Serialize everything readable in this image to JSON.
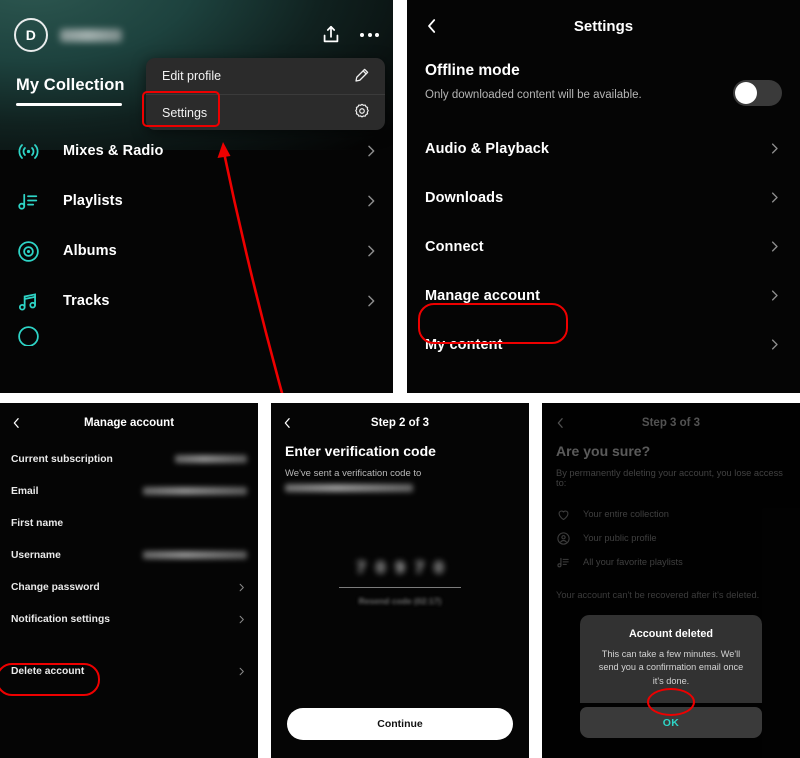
{
  "collection": {
    "avatar_initial": "D",
    "username_redacted": true,
    "title": "My Collection",
    "actions": [
      {
        "name": "share-icon",
        "label": "Share"
      },
      {
        "name": "more-icon",
        "label": "More"
      }
    ],
    "menu": [
      {
        "label": "Edit profile",
        "icon": "pencil-icon"
      },
      {
        "label": "Settings",
        "icon": "gear-icon",
        "highlighted": true
      }
    ],
    "items": [
      {
        "label": "Mixes & Radio",
        "icon": "radio-waves-icon"
      },
      {
        "label": "Playlists",
        "icon": "playlist-icon"
      },
      {
        "label": "Albums",
        "icon": "disc-icon"
      },
      {
        "label": "Tracks",
        "icon": "music-note-icon"
      }
    ],
    "accent": "#2ed4c6"
  },
  "settings": {
    "nav_title": "Settings",
    "back_icon": "chevron-left-icon",
    "offline": {
      "title": "Offline mode",
      "subtitle": "Only downloaded content will be available.",
      "toggle_state": "off"
    },
    "rows": [
      {
        "label": "Audio & Playback",
        "highlighted": false
      },
      {
        "label": "Downloads",
        "highlighted": false
      },
      {
        "label": "Connect",
        "highlighted": false
      },
      {
        "label": "Manage account",
        "highlighted": true
      },
      {
        "label": "My content",
        "highlighted": false
      }
    ]
  },
  "manage": {
    "nav_title": "Manage account",
    "rows": [
      {
        "label": "Current subscription",
        "value_redacted": true,
        "value_width": 72,
        "chevron": false
      },
      {
        "label": "Email",
        "value_redacted": true,
        "value_width": 104,
        "chevron": false
      },
      {
        "label": "First name",
        "value_redacted": false,
        "value_width": 0,
        "chevron": false
      },
      {
        "label": "Username",
        "value_redacted": true,
        "value_width": 104,
        "chevron": false
      },
      {
        "label": "Change password",
        "value_redacted": false,
        "value_width": 0,
        "chevron": true
      },
      {
        "label": "Notification settings",
        "value_redacted": false,
        "value_width": 0,
        "chevron": true
      },
      {
        "label": "Delete account",
        "value_redacted": false,
        "value_width": 0,
        "chevron": true,
        "highlighted": true
      }
    ]
  },
  "verify": {
    "nav_title": "Step 2 of 3",
    "title": "Enter verification code",
    "subtitle": "We've sent a verification code to",
    "email_redacted": true,
    "code_value": "70970",
    "resend_label": "Resend code (02:17)",
    "continue_label": "Continue"
  },
  "sure": {
    "nav_title": "Step 3 of 3",
    "title": "Are you sure?",
    "description": "By permanently deleting your account, you lose access to:",
    "items": [
      {
        "label": "Your entire collection",
        "icon": "heart-icon"
      },
      {
        "label": "Your public profile",
        "icon": "profile-circle-icon"
      },
      {
        "label": "All your favorite playlists",
        "icon": "playlist-icon"
      }
    ],
    "note": "Your account can't be recovered after it's deleted.",
    "dialog": {
      "title": "Account deleted",
      "message": "This can take a few minutes. We'll send you a confirmation email once it's done.",
      "ok_label": "OK",
      "ok_color": "#2ed4c6"
    }
  },
  "annotation": {
    "color": "#ee0000"
  }
}
